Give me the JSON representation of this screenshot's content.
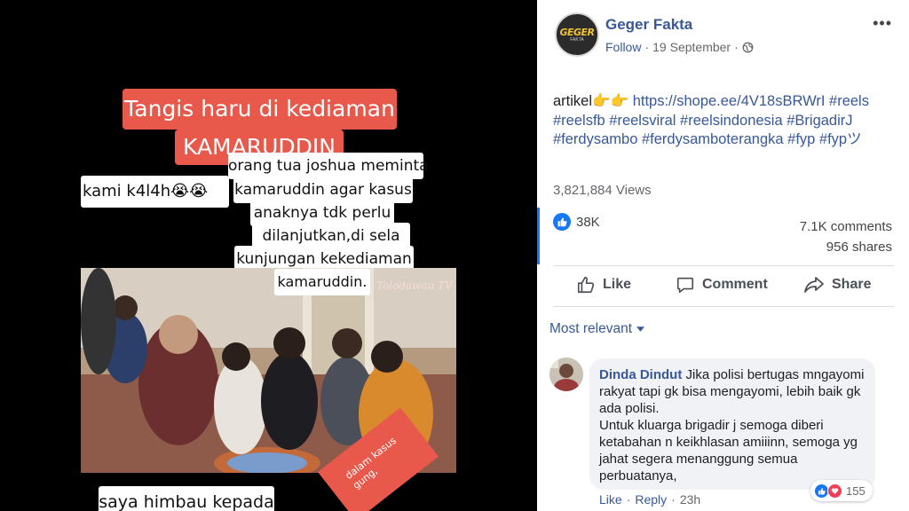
{
  "video": {
    "captions": {
      "title_line1": "Tangis haru di kediaman",
      "title_line2": "KAMARUDDIN",
      "left_caption": "kami k4l4h😭😭",
      "lines": [
        "orang tua joshua meminta",
        "kamaruddin agar kasus",
        "anaknya tdk perlu",
        "dilanjutkan,di sela",
        "kunjungan kekediaman",
        "kamaruddin."
      ],
      "bottom_white": "saya himbau kepada",
      "bottom_red": "dalam kasus\ngung,"
    },
    "watermark": "Tolodawau TV"
  },
  "post": {
    "avatar_logo": "GEGER",
    "avatar_sub": "FAKTA",
    "page_name": "Geger Fakta",
    "follow": "Follow",
    "date": "19 September",
    "separator": "·",
    "privacy_icon": "globe-icon",
    "more_icon": "more-options-icon",
    "more_glyph": "•••",
    "text_prefix": "artikel👉👉 ",
    "link": "https://shope.ee/4V18sBRWrI",
    "hashtags": " #reels #reelsfb #reelsviral #reelsindonesia #BrigadirJ #ferdysambo #ferdysamboterangka #fyp #fypツ",
    "views": "3,821,884 Views",
    "likes": "38K",
    "comments": "7.1K comments",
    "shares": "956 shares",
    "actions": {
      "like": "Like",
      "comment": "Comment",
      "share": "Share"
    },
    "sort_label": "Most relevant"
  },
  "comment": {
    "author": "Dinda Dindut",
    "text_first": " Jika polisi bertugas mngayomi rakyat tapi gk bisa mengayomi, lebih baik gk ada polisi.",
    "text_rest": "Untuk kluarga brigadir j semoga diberi ketabahan n keikhlasan amiiinn, semoga yg jahat segera menanggung semua perbuatanya,",
    "reactions": "155",
    "like": "Like",
    "reply": "Reply",
    "time": "23h",
    "separator": "·"
  },
  "colors": {
    "link_blue": "#385898",
    "fb_blue": "#1877f2",
    "caption_red": "#e8584b",
    "love_red": "#f33e58"
  }
}
